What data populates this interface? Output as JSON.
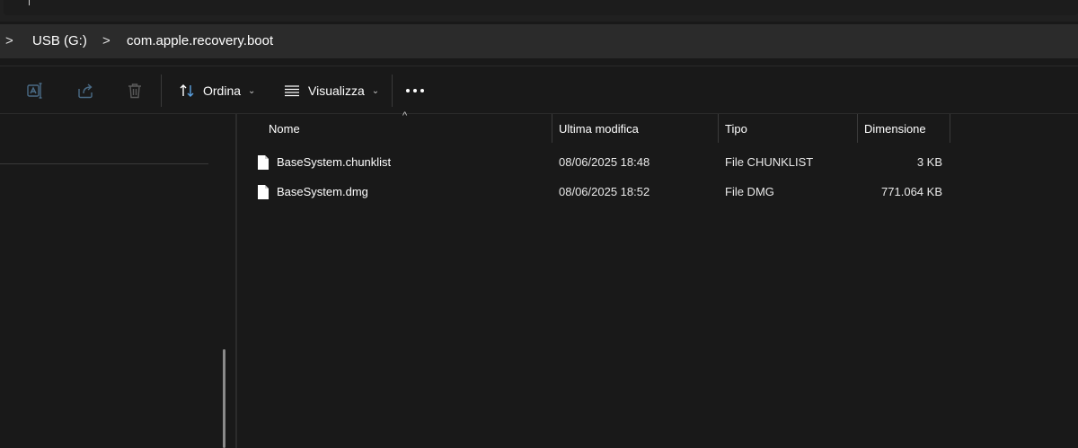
{
  "breadcrumb": {
    "items": [
      "USB (G:)",
      "com.apple.recovery.boot"
    ],
    "separator": ">"
  },
  "toolbar": {
    "icons": [
      "rename-icon",
      "share-icon",
      "delete-icon"
    ],
    "sort_label": "Ordina",
    "view_label": "Visualizza",
    "chevron": "⌄",
    "more_icon": "more-options-icon"
  },
  "columns": {
    "name": "Nome",
    "modified": "Ultima modifica",
    "type": "Tipo",
    "size": "Dimensione",
    "sort_indicator": "^"
  },
  "files": [
    {
      "name": "BaseSystem.chunklist",
      "modified": "08/06/2025 18:48",
      "type": "File CHUNKLIST",
      "size": "3 KB",
      "icon": "file-icon"
    },
    {
      "name": "BaseSystem.dmg",
      "modified": "08/06/2025 18:52",
      "type": "File DMG",
      "size": "771.064 KB",
      "icon": "file-icon"
    }
  ],
  "colors": {
    "background": "#191919",
    "address_bar": "#2b2b2b",
    "accent_sort_arrow": "#5aa0e0"
  }
}
